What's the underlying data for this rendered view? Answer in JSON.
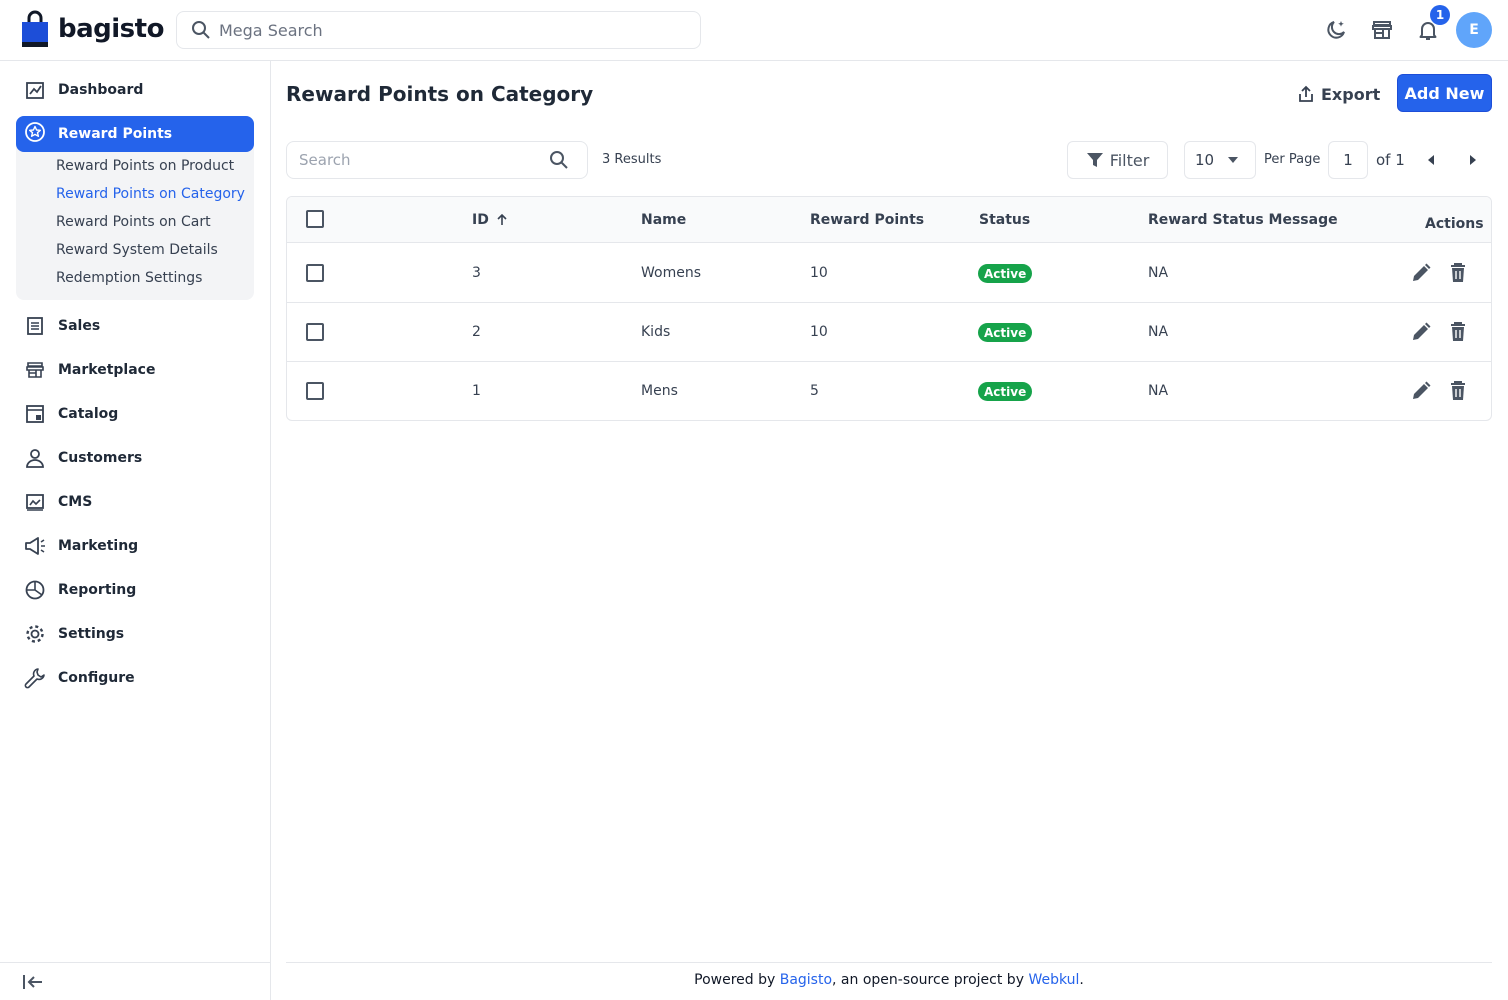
{
  "brand": {
    "name": "bagisto",
    "primary_color": "#2563eb"
  },
  "header": {
    "search_placeholder": "Mega Search",
    "notification_count": "1",
    "avatar_initial": "E"
  },
  "sidebar": {
    "items": [
      {
        "label": "Dashboard",
        "icon": "dashboard-icon"
      },
      {
        "label": "Reward Points",
        "icon": "star-icon",
        "active": true
      },
      {
        "label": "Sales",
        "icon": "receipt-icon"
      },
      {
        "label": "Marketplace",
        "icon": "store-icon"
      },
      {
        "label": "Catalog",
        "icon": "catalog-icon"
      },
      {
        "label": "Customers",
        "icon": "user-icon"
      },
      {
        "label": "CMS",
        "icon": "cms-icon"
      },
      {
        "label": "Marketing",
        "icon": "megaphone-icon"
      },
      {
        "label": "Reporting",
        "icon": "pie-chart-icon"
      },
      {
        "label": "Settings",
        "icon": "gear-icon"
      },
      {
        "label": "Configure",
        "icon": "wrench-icon"
      }
    ],
    "sub_items": [
      {
        "label": "Reward Points on Product"
      },
      {
        "label": "Reward Points on Category",
        "active": true
      },
      {
        "label": "Reward Points on Cart"
      },
      {
        "label": "Reward System Details"
      },
      {
        "label": "Redemption Settings"
      }
    ]
  },
  "main": {
    "title": "Reward Points on Category",
    "export_label": "Export",
    "add_label": "Add New",
    "search_placeholder": "Search",
    "results": "3 Results",
    "filter_label": "Filter",
    "per_page_value": "10",
    "per_page_label": "Per Page",
    "page_current": "1",
    "page_of": "of 1"
  },
  "table": {
    "columns": [
      "ID",
      "Name",
      "Reward Points",
      "Status",
      "Reward Status Message",
      "Actions"
    ],
    "rows": [
      {
        "id": "3",
        "name": "Womens",
        "points": "10",
        "status": "Active",
        "message": "NA"
      },
      {
        "id": "2",
        "name": "Kids",
        "points": "10",
        "status": "Active",
        "message": "NA"
      },
      {
        "id": "1",
        "name": "Mens",
        "points": "5",
        "status": "Active",
        "message": "NA"
      }
    ]
  },
  "footer": {
    "prefix": "Powered by ",
    "link1": "Bagisto",
    "middle": ", an open-source project by ",
    "link2": "Webkul",
    "suffix": "."
  }
}
